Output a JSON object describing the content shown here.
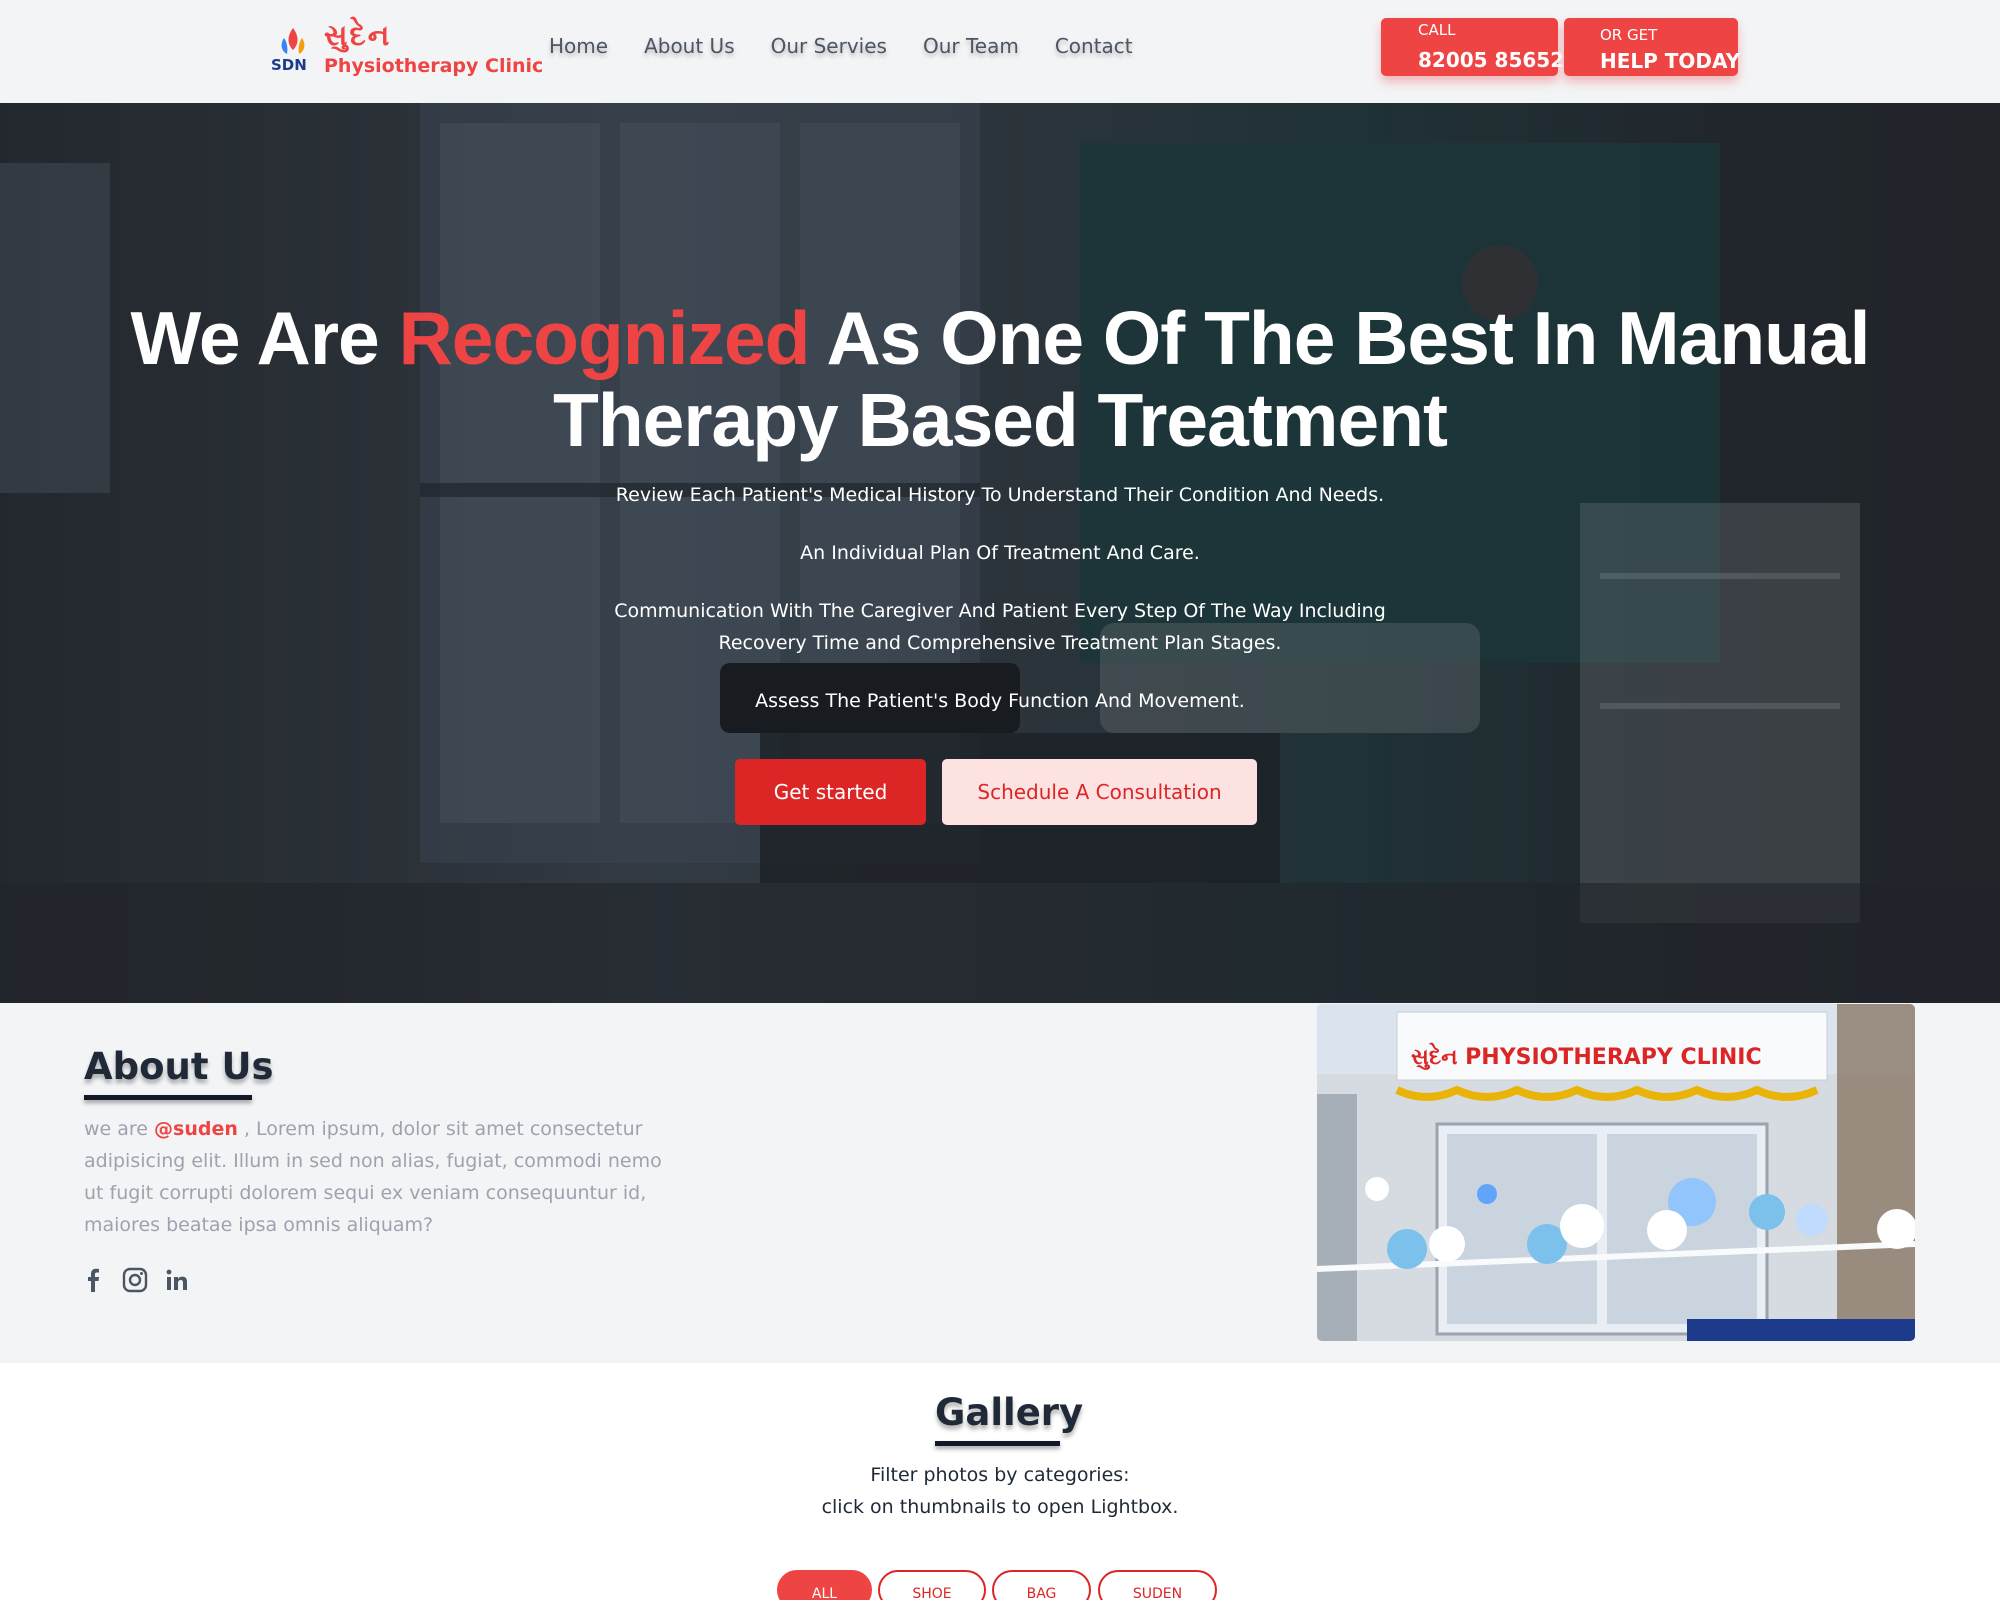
{
  "header": {
    "logo_script": "સુદેન",
    "logo_subtitle": "Physiotherapy Clinic",
    "nav": [
      "Home",
      "About Us",
      "Our Servies",
      "Our Team",
      "Contact"
    ],
    "call_small": "CALL",
    "call_number": "82005 85652",
    "help_small": "OR GET",
    "help_big": "HELP TODAY"
  },
  "hero": {
    "title_before": "We Are ",
    "title_highlight": "Recognized",
    "title_after": " As One Of The Best In Manual Therapy Based Treatment",
    "points": [
      "Review Each Patient's Medical History To Understand Their Condition And Needs.",
      "An Individual Plan Of Treatment And Care.",
      "Communication With The Caregiver And Patient Every Step Of The Way Including Recovery Time and Comprehensive Treatment Plan Stages.",
      "Assess The Patient's Body Function And Movement."
    ],
    "btn_primary": "Get started",
    "btn_secondary": "Schedule A Consultation"
  },
  "about": {
    "heading": "About Us",
    "text_before": "we are ",
    "handle": "@suden",
    "text_after": " , Lorem ipsum, dolor sit amet consectetur adipisicing elit. Illum in sed non alias, fugiat, commodi nemo ut fugit corrupti dolorem sequi ex veniam consequuntur id, maiores beatae ipsa omnis aliquam?",
    "social": [
      "facebook-icon",
      "instagram-icon",
      "linkedin-icon"
    ],
    "photo_sign": "સુદેન PHYSIOTHERAPY CLINIC"
  },
  "gallery": {
    "heading": "Gallery",
    "line1": "Filter photos by categories:",
    "line2": "click on thumbnails to open Lightbox.",
    "filters": [
      "ALL",
      "SHOE",
      "BAG",
      "SUDEN"
    ],
    "active_filter": "ALL"
  },
  "colors": {
    "accent": "#ef4444",
    "accent_dark": "#dc2626",
    "page_bg": "#f3f4f6"
  }
}
